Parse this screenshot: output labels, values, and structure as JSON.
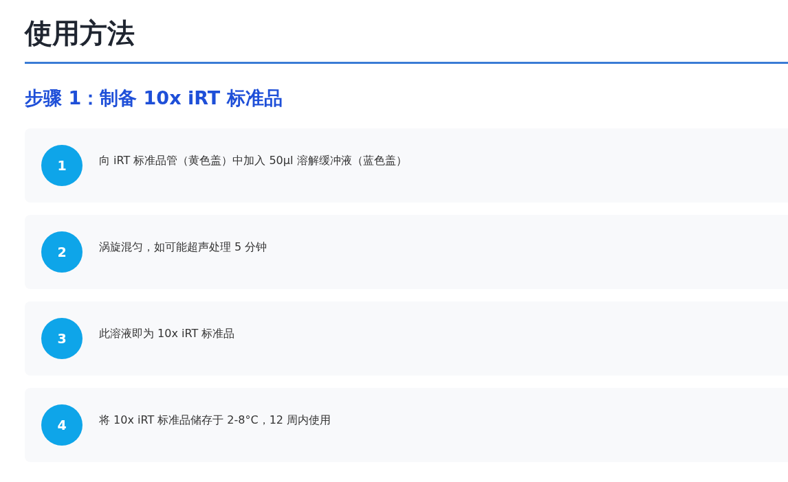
{
  "title": "使用方法",
  "section": {
    "heading": "步骤 1：制备 10x iRT 标准品",
    "steps": [
      {
        "number": "1",
        "text": "向 iRT 标准品管（黄色盖）中加入 50µl 溶解缓冲液（蓝色盖）"
      },
      {
        "number": "2",
        "text": "涡旋混匀，如可能超声处理 5 分钟"
      },
      {
        "number": "3",
        "text": "此溶液即为 10x iRT 标准品"
      },
      {
        "number": "4",
        "text": "将 10x iRT 标准品储存于 2-8°C，12 周内使用"
      }
    ]
  }
}
